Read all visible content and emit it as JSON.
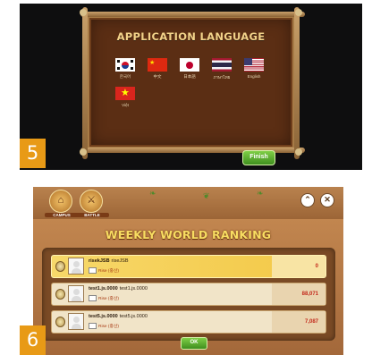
{
  "panel5": {
    "step_number": "5",
    "dialog_title": "APPLICATION LANGUAGE",
    "languages": [
      {
        "label": "한국어",
        "flag": "south-korea-flag"
      },
      {
        "label": "中文",
        "flag": "china-flag"
      },
      {
        "label": "日本語",
        "flag": "japan-flag"
      },
      {
        "label": "ภาษาไทย",
        "flag": "thailand-flag"
      },
      {
        "label": "English",
        "flag": "usa-flag"
      },
      {
        "label": "Việt",
        "flag": "vietnam-flag"
      }
    ],
    "finish_label": "Finish"
  },
  "panel6": {
    "step_number": "6",
    "campus_label": "CAMPUS",
    "battle_label": "BATTLE",
    "up_icon": "chevron-up-icon",
    "close_icon": "close-icon",
    "title": "WEEKLY WORLD RANKING",
    "rows": [
      {
        "name": "risekJSB",
        "sub": "riseJSB",
        "info": "Rise (중산)",
        "score": "0",
        "highlight": true
      },
      {
        "name": "test1.js.0000",
        "sub": "test1.js.0000",
        "info": "Rise (중산)",
        "score": "88,071",
        "highlight": false
      },
      {
        "name": "test5.js.0000",
        "sub": "test5.js.0000",
        "info": "Rise (중산)",
        "score": "7,087",
        "highlight": false
      }
    ],
    "ok_label": "OK"
  },
  "colors": {
    "step_badge": "#e89a16",
    "title_gold": "#f8dd62",
    "button_green": "#4fa52a"
  }
}
